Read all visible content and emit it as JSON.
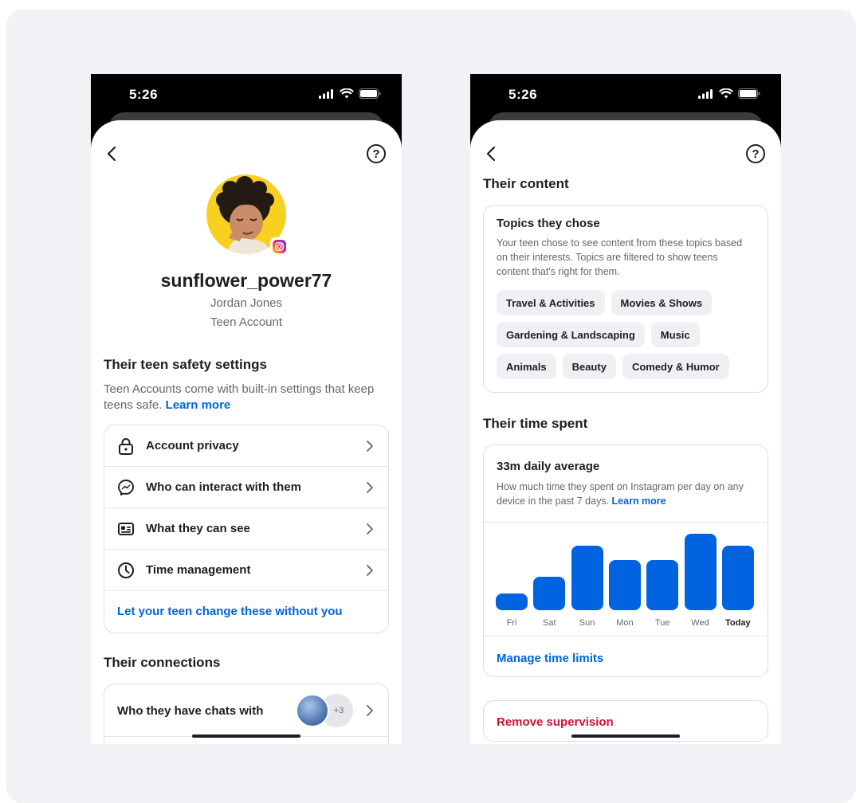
{
  "left_phone": {
    "status_time": "5:26",
    "username": "sunflower_power77",
    "full_name": "Jordan Jones",
    "account_type": "Teen Account",
    "safety": {
      "title": "Their teen safety settings",
      "description": "Teen Accounts come with built-in settings that keep teens safe.",
      "learn_more": "Learn more",
      "items": [
        {
          "label": "Account privacy",
          "icon": "lock-icon"
        },
        {
          "label": "Who can interact with them",
          "icon": "messenger-icon"
        },
        {
          "label": "What they can see",
          "icon": "id-card-icon"
        },
        {
          "label": "Time management",
          "icon": "clock-icon"
        }
      ],
      "change_link": "Let your teen change these without you"
    },
    "connections": {
      "title": "Their connections",
      "chats_label": "Who they have chats with",
      "more_count": "+3"
    }
  },
  "right_phone": {
    "status_time": "5:26",
    "content": {
      "title": "Their content",
      "card_title": "Topics they chose",
      "card_desc": "Your teen chose to see content from these topics based on their interests. Topics are filtered to show teens content that's right for them.",
      "topics": [
        "Travel & Activities",
        "Movies & Shows",
        "Gardening & Landscaping",
        "Music",
        "Animals",
        "Beauty",
        "Comedy & Humor"
      ]
    },
    "time_spent": {
      "title": "Their time spent",
      "card_title": "33m daily average",
      "card_desc": "How much time they spent on Instagram per day on any device in the past 7 days.",
      "learn_more": "Learn more",
      "manage_link": "Manage time limits"
    },
    "remove_label": "Remove supervision"
  },
  "colors": {
    "accent": "#0064e0",
    "danger": "#d0103a",
    "avatar_bg": "#f7d021"
  },
  "chart_data": {
    "type": "bar",
    "categories": [
      "Fri",
      "Sat",
      "Sun",
      "Mon",
      "Tue",
      "Wed",
      "Today"
    ],
    "values": [
      0.22,
      0.44,
      0.84,
      0.66,
      0.66,
      1.0,
      0.84
    ],
    "highlight": "Today",
    "ylim": [
      0,
      1
    ]
  }
}
